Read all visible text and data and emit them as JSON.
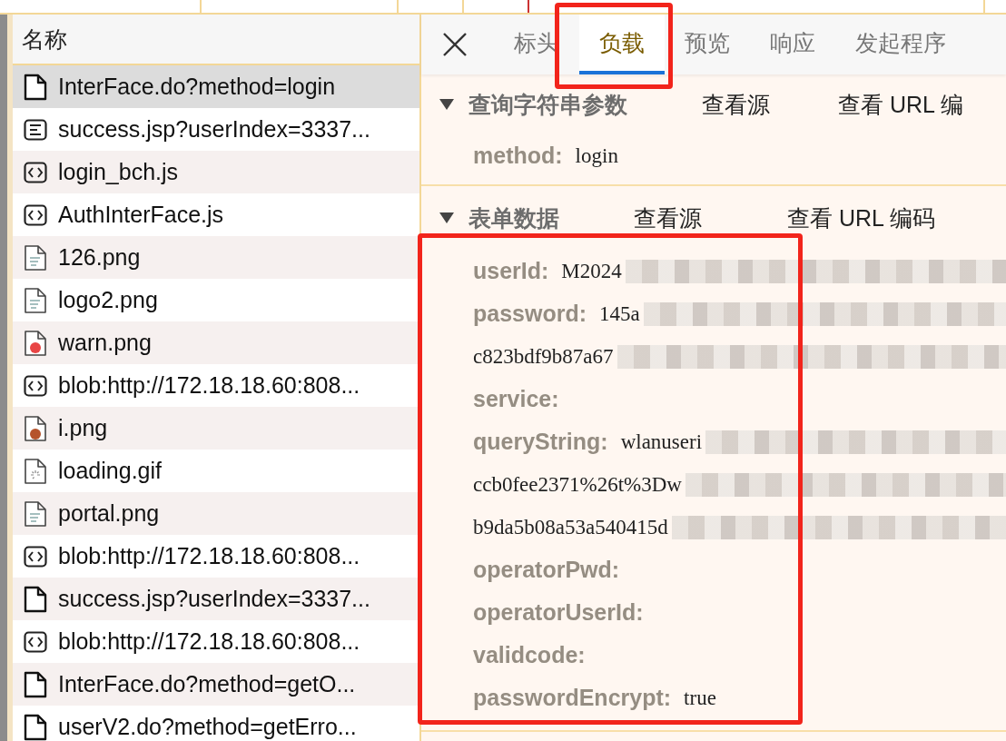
{
  "request_list": {
    "column": "名称",
    "rows": [
      {
        "name": "InterFace.do?method=login",
        "kind": "doc",
        "selected": true
      },
      {
        "name": "success.jsp?userIndex=3337...",
        "kind": "text",
        "selected": false
      },
      {
        "name": "login_bch.js",
        "kind": "script",
        "selected": false
      },
      {
        "name": "AuthInterFace.js",
        "kind": "script",
        "selected": false
      },
      {
        "name": "126.png",
        "kind": "image",
        "selected": false
      },
      {
        "name": "logo2.png",
        "kind": "image",
        "selected": false
      },
      {
        "name": "warn.png",
        "kind": "warning-image",
        "selected": false
      },
      {
        "name": "blob:http://172.18.18.60:808...",
        "kind": "script",
        "selected": false
      },
      {
        "name": "i.png",
        "kind": "info-image",
        "selected": false
      },
      {
        "name": "loading.gif",
        "kind": "spinner-image",
        "selected": false
      },
      {
        "name": "portal.png",
        "kind": "image",
        "selected": false
      },
      {
        "name": "blob:http://172.18.18.60:808...",
        "kind": "script",
        "selected": false
      },
      {
        "name": "success.jsp?userIndex=3337...",
        "kind": "doc",
        "selected": false
      },
      {
        "name": "blob:http://172.18.18.60:808...",
        "kind": "script",
        "selected": false
      },
      {
        "name": "InterFace.do?method=getO...",
        "kind": "doc",
        "selected": false
      },
      {
        "name": "userV2.do?method=getErro...",
        "kind": "doc",
        "selected": false
      }
    ]
  },
  "tabs": [
    {
      "label": "标头",
      "selected": false
    },
    {
      "label": "负载",
      "selected": true
    },
    {
      "label": "预览",
      "selected": false
    },
    {
      "label": "响应",
      "selected": false
    },
    {
      "label": "发起程序",
      "selected": false
    }
  ],
  "sections": [
    {
      "title": "查询字符串参数",
      "expanded": true,
      "links": [
        "查看源",
        "查看 URL 编"
      ],
      "fields": [
        {
          "key": "method:",
          "value": "login",
          "redacted": false
        }
      ]
    },
    {
      "title": "表单数据",
      "expanded": true,
      "links": [
        "查看源",
        "查看 URL 编码"
      ],
      "fields": [
        {
          "key": "userId:",
          "value": "M2024",
          "redacted": true
        },
        {
          "key": "password:",
          "value": "145a",
          "redacted": true
        },
        {
          "value": "c823bdf9b87a67",
          "redacted": true
        },
        {
          "key": "service:",
          "redacted": false
        },
        {
          "key": "queryString:",
          "value": "wlanuseri",
          "redacted": true
        },
        {
          "value": "ccb0fee2371%26t%3Dw",
          "redacted": true
        },
        {
          "value": "b9da5b08a53a540415d",
          "redacted": true
        },
        {
          "key": "operatorPwd:",
          "redacted": false
        },
        {
          "key": "operatorUserId:",
          "redacted": false
        },
        {
          "key": "validcode:",
          "redacted": false
        },
        {
          "key": "passwordEncrypt:",
          "value": "true",
          "redacted": false
        }
      ]
    }
  ]
}
